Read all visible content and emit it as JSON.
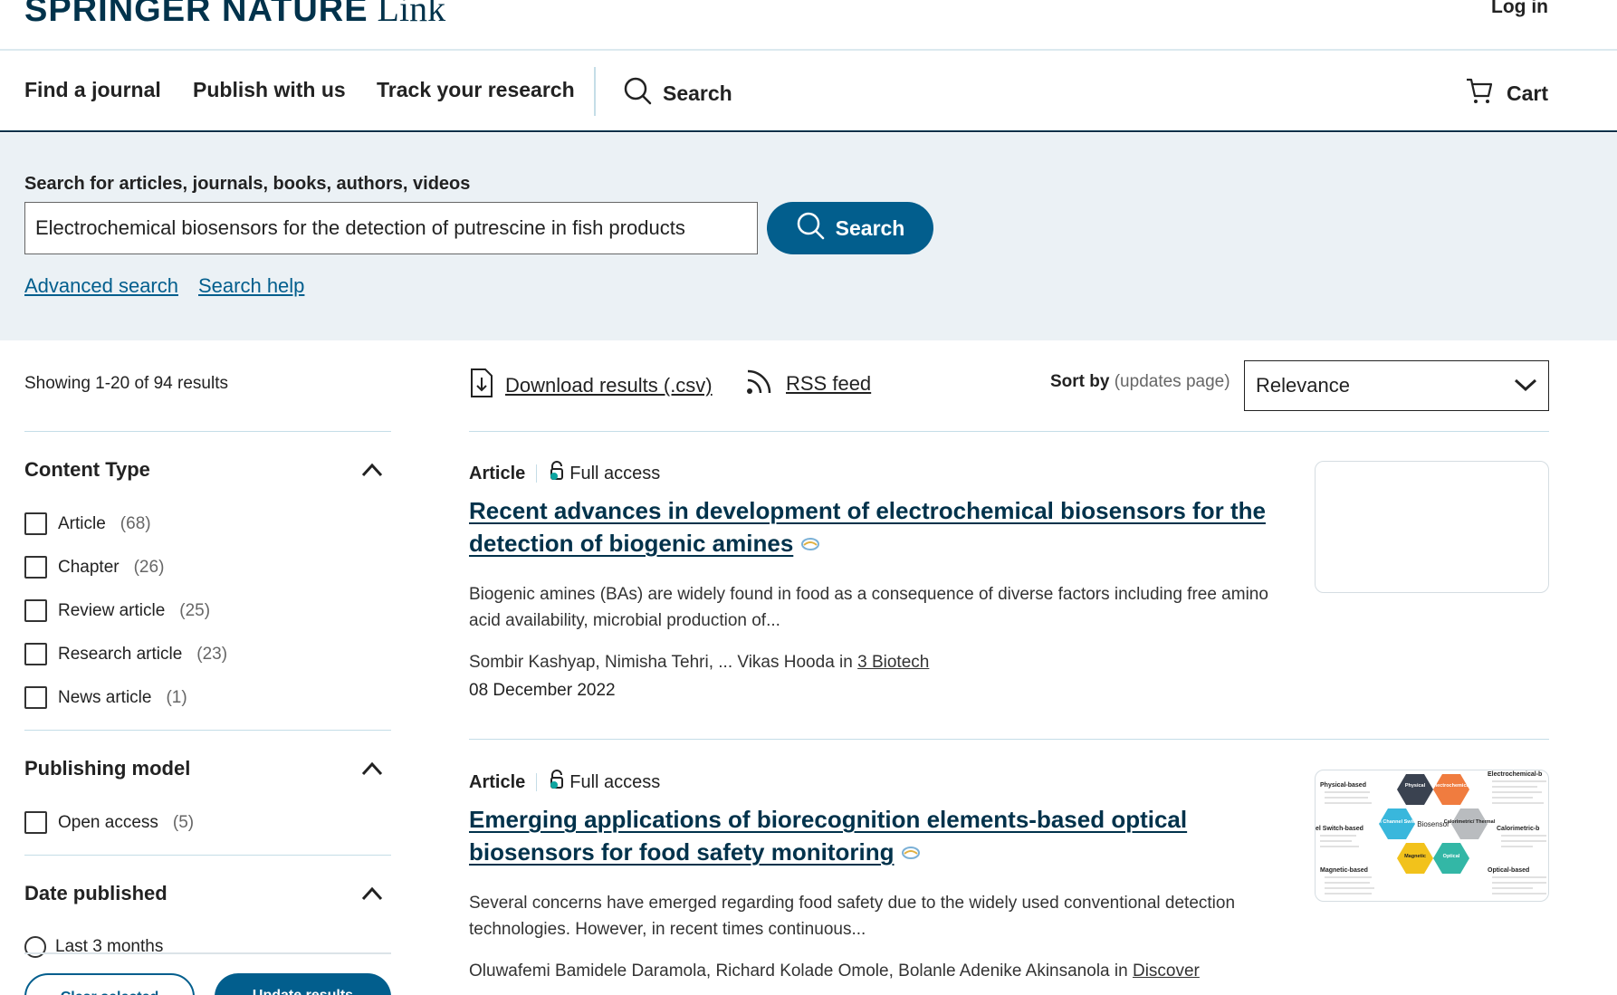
{
  "header": {
    "brand": "SPRINGER NATURE",
    "product": "Link",
    "login_label": "Log in"
  },
  "nav": {
    "find_journal": "Find a journal",
    "publish": "Publish with us",
    "track": "Track your research",
    "search": "Search",
    "cart": "Cart"
  },
  "search": {
    "label": "Search for articles, journals, books, authors, videos",
    "query": "Electrochemical biosensors for the detection of putrescine in fish products",
    "button": "Search",
    "advanced": "Advanced search",
    "help": "Search help"
  },
  "results_bar": {
    "showing": "Showing 1-20 of 94 results",
    "download": "Download results (.csv)",
    "rss": "RSS feed",
    "sort_label": "Sort by",
    "sort_hint": "(updates page)",
    "sort_value": "Relevance"
  },
  "filters": {
    "content_type": {
      "title": "Content Type",
      "options": [
        {
          "label": "Article",
          "count": "(68)"
        },
        {
          "label": "Chapter",
          "count": "(26)"
        },
        {
          "label": "Review article",
          "count": "(25)"
        },
        {
          "label": "Research article",
          "count": "(23)"
        },
        {
          "label": "News article",
          "count": "(1)"
        }
      ]
    },
    "publishing_model": {
      "title": "Publishing model",
      "options": [
        {
          "label": "Open access",
          "count": "(5)"
        }
      ]
    },
    "date_published": {
      "title": "Date published",
      "first_option": "Last 3 months"
    },
    "clear_label": "Clear selected",
    "update_label": "Update results"
  },
  "results": [
    {
      "type": "Article",
      "access": "Full access",
      "title": "Recent advances in development of electrochemical biosensors for the detection of biogenic amines",
      "snippet": "Biogenic amines (BAs) are widely found in food as a consequence of diverse factors including free amino acid availability, microbial production of...",
      "authors": "Sombir Kashyap, Nimisha Tehri, ... Vikas Hooda",
      "in_label": "in",
      "journal": "3 Biotech",
      "date": "08 December 2022"
    },
    {
      "type": "Article",
      "access": "Full access",
      "title": "Emerging applications of biorecognition elements-based optical biosensors for food safety monitoring",
      "snippet": "Several concerns have emerged regarding food safety due to the widely used conventional detection technologies. However, in recent times continuous...",
      "authors": "Oluwafemi Bamidele Daramola, Richard Kolade Omole, Bolanle Adenike Akinsanola",
      "in_label": "in",
      "journal": "Discover"
    }
  ],
  "figure2": {
    "labels": {
      "physical_based": "Physical-based",
      "electrochemical_based": "Electrochemical-b",
      "switch_based": "el Switch-based",
      "calorimetric_based": "Calorimetric-b",
      "magnetic_based": "Magnetic-based",
      "optical_based": "Optical-based",
      "center": "Biosensor",
      "hex_physical": "Physical",
      "hex_electrochemical": "Electrochemical",
      "hex_ion": "Ion Channel Switch",
      "hex_thermal": "Calorimetric/ Thermal",
      "hex_magnetic": "Magnetic",
      "hex_optical": "Optical"
    },
    "colors": {
      "physical": "#3a4250",
      "electrochemical": "#f07c3f",
      "ion": "#39b7dc",
      "thermal": "#b9bcbf",
      "magnetic": "#f2c21b",
      "optical": "#33b7a6"
    }
  },
  "icons": {
    "search": "search-icon",
    "cart": "cart-icon",
    "download": "download-icon",
    "rss": "rss-icon",
    "chevron_up": "chevron-up-icon",
    "chevron_down": "chevron-down-icon",
    "access": "open-lock-icon",
    "altmetric": "altmetric-icon"
  },
  "colors": {
    "brand": "#01324b",
    "accent": "#025e8d",
    "band": "#ebf1f5",
    "divider": "#c5dde7",
    "access_dot": "#0ea5a0"
  }
}
